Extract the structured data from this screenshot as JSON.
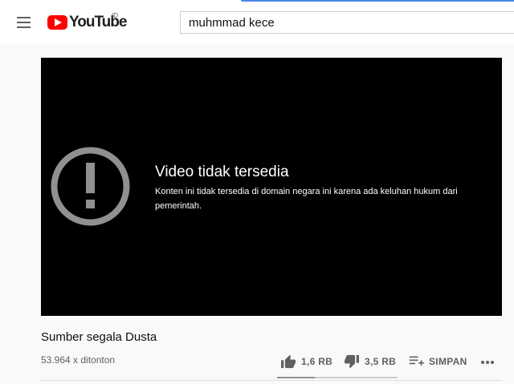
{
  "header": {
    "logo_text": "YouTube",
    "country_code": "ID",
    "search_value": "muhmmad kece"
  },
  "player": {
    "error_title": "Video tidak tersedia",
    "error_message": "Konten ini tidak tersedia di domain negara ini karena ada keluhan hukum dari pemerintah."
  },
  "video": {
    "title": "Sumber segala Dusta",
    "views": "53.964 x ditonton",
    "like_count": "1,6 RB",
    "dislike_count": "3,5 RB",
    "save_label": "SIMPAN",
    "like_ratio": 0.31
  },
  "colors": {
    "brand_red": "#ff0000",
    "player_bg": "#000000",
    "icon_gray": "#606060",
    "accent_blue": "#4a86e8"
  }
}
